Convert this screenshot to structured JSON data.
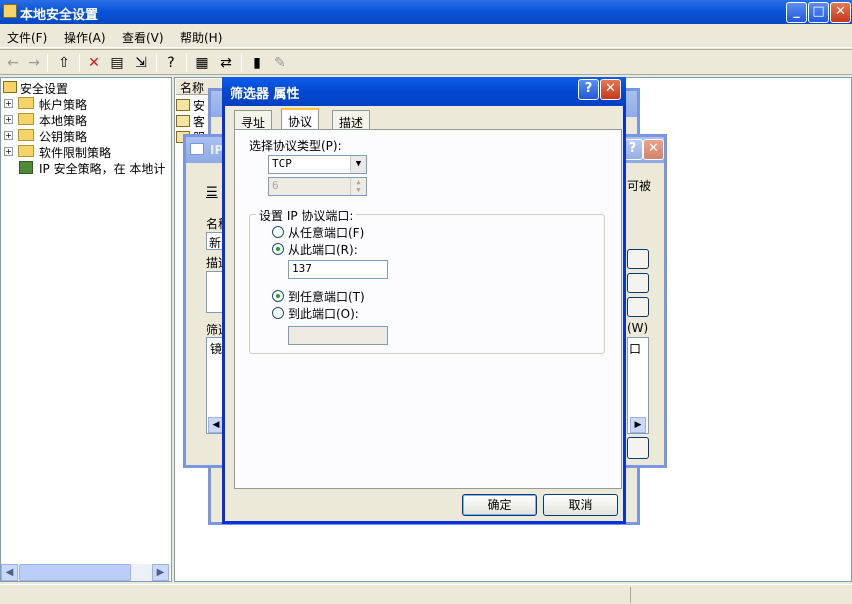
{
  "window": {
    "title": "本地安全设置"
  },
  "menu": [
    {
      "label": "文件(F)"
    },
    {
      "label": "操作(A)"
    },
    {
      "label": "查看(V)"
    },
    {
      "label": "帮助(H)"
    }
  ],
  "toolbar": {
    "icons": [
      "back-arrow-icon",
      "forward-arrow-icon",
      "up-folder-icon",
      "delete-icon",
      "properties-icon",
      "export-icon",
      "help-icon",
      "new-policy-icon",
      "assign-icon",
      "run-icon",
      "edit-icon"
    ]
  },
  "tree": {
    "root": "安全设置",
    "items": [
      {
        "label": "帐户策略"
      },
      {
        "label": "本地策略"
      },
      {
        "label": "公钥策略"
      },
      {
        "label": "软件限制策略"
      },
      {
        "label": "IP 安全策略，在 本地计"
      }
    ]
  },
  "list": {
    "header": "名称",
    "rows": [
      "安",
      "客",
      "服"
    ]
  },
  "ip_dialog": {
    "title": "IP",
    "partial_right": "可被",
    "labels": [
      "名称",
      "新",
      "描述",
      "筛选",
      "镜"
    ],
    "side_text": "(W)",
    "col_tail": "口"
  },
  "filter_dialog": {
    "title": "筛选器 属性",
    "tabs": [
      {
        "label": "寻址"
      },
      {
        "label": "协议"
      },
      {
        "label": "描述"
      }
    ],
    "protocol_type_label": "选择协议类型(P):",
    "protocol_value": "TCP",
    "protocol_number": "6",
    "port_group_label": "设置 IP 协议端口:",
    "from_any_label": "从任意端口(F)",
    "from_this_label": "从此端口(R):",
    "from_port_value": "137",
    "to_any_label": "到任意端口(T)",
    "to_this_label": "到此端口(O):",
    "to_port_value": "",
    "ok_label": "确定",
    "cancel_label": "取消",
    "help_glyph": "?",
    "close_glyph": "✕"
  }
}
